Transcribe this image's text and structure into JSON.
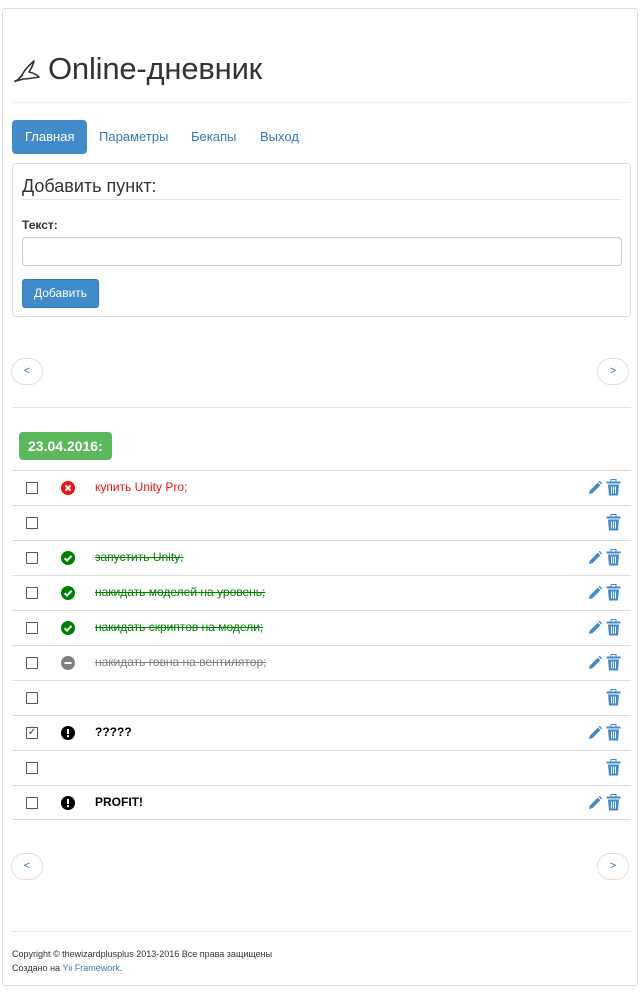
{
  "site": {
    "title": "Online-дневник"
  },
  "nav": {
    "items": [
      {
        "label": "Главная",
        "active": true
      },
      {
        "label": "Параметры",
        "active": false
      },
      {
        "label": "Бекапы",
        "active": false
      },
      {
        "label": "Выход",
        "active": false
      }
    ]
  },
  "add_form": {
    "title": "Добавить пункт:",
    "text_label": "Текст:",
    "text_value": "",
    "button_label": "Добавить"
  },
  "pager": {
    "prev": "<",
    "next": ">"
  },
  "date": "23.04.2016:",
  "colors": {
    "accent": "#428bca",
    "date_badge": "#5cb85c",
    "failed": "#ee1111",
    "done": "#008000",
    "cancelled": "#808080",
    "important": "#000000"
  },
  "items": [
    {
      "text": "купить Unity Pro;",
      "status": "failed",
      "status_icon": "cross-circle-icon",
      "checked": false,
      "editable": true
    },
    {
      "text": "",
      "status": "none",
      "status_icon": "",
      "checked": false,
      "editable": false
    },
    {
      "text": "запустить Unity;",
      "status": "done",
      "status_icon": "check-circle-icon",
      "checked": false,
      "editable": true
    },
    {
      "text": "накидать моделей на уровень;",
      "status": "done",
      "status_icon": "check-circle-icon",
      "checked": false,
      "editable": true
    },
    {
      "text": "накидать скриптов на модели;",
      "status": "done",
      "status_icon": "check-circle-icon",
      "checked": false,
      "editable": true
    },
    {
      "text": "накидать говна на вентилятор;",
      "status": "cancelled",
      "status_icon": "minus-circle-icon",
      "checked": false,
      "editable": true
    },
    {
      "text": "",
      "status": "none",
      "status_icon": "",
      "checked": false,
      "editable": false
    },
    {
      "text": "?????",
      "status": "important",
      "status_icon": "exclamation-circle-icon",
      "checked": true,
      "editable": true
    },
    {
      "text": "",
      "status": "none",
      "status_icon": "",
      "checked": false,
      "editable": false
    },
    {
      "text": "PROFIT!",
      "status": "important",
      "status_icon": "exclamation-circle-icon",
      "checked": false,
      "editable": true
    }
  ],
  "footer": {
    "copyright": "Copyright © thewizardplusplus 2013-2016 Все права защищены",
    "made_with_prefix": "Создано на ",
    "made_with_link": "Yii Framework",
    "made_with_suffix": "."
  }
}
